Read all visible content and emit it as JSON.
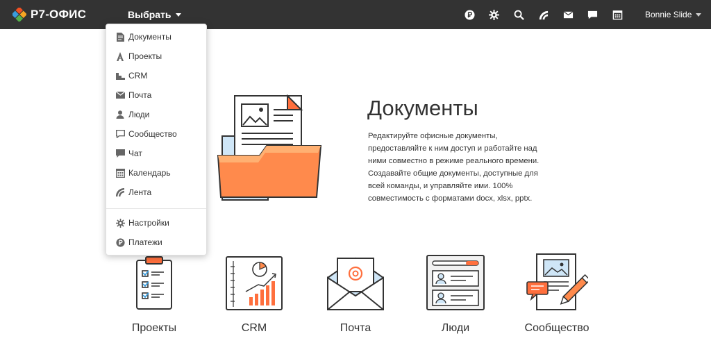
{
  "brand": {
    "name": "Р7-ОФИС"
  },
  "header": {
    "select_label": "Выбрать",
    "user_name": "Bonnie Slide",
    "icons": [
      "ruble-icon",
      "gear-icon",
      "search-icon",
      "feed-icon",
      "mail-icon",
      "chat-icon",
      "calendar-icon"
    ]
  },
  "dropdown": {
    "items": [
      {
        "label": "Документы",
        "icon": "document-icon"
      },
      {
        "label": "Проекты",
        "icon": "projects-icon"
      },
      {
        "label": "CRM",
        "icon": "crm-icon"
      },
      {
        "label": "Почта",
        "icon": "mail-icon"
      },
      {
        "label": "Люди",
        "icon": "person-icon"
      },
      {
        "label": "Сообщество",
        "icon": "community-icon"
      },
      {
        "label": "Чат",
        "icon": "chat-icon"
      },
      {
        "label": "Календарь",
        "icon": "calendar-icon"
      },
      {
        "label": "Лента",
        "icon": "feed-icon"
      }
    ],
    "bottom_items": [
      {
        "label": "Настройки",
        "icon": "gear-icon"
      },
      {
        "label": "Платежи",
        "icon": "ruble-icon"
      }
    ]
  },
  "hero": {
    "title": "Документы",
    "description": "Редактируйте офисные документы, предоставляйте к ним доступ и работайте над ними совместно в режиме реального времени. Создавайте общие документы, доступные для всей команды, и управляйте ими. 100% совместимость с форматами docx, xlsx, pptx."
  },
  "modules": [
    {
      "label": "Проекты",
      "icon": "projects-clipboard-icon"
    },
    {
      "label": "CRM",
      "icon": "crm-chart-icon"
    },
    {
      "label": "Почта",
      "icon": "mail-envelope-icon"
    },
    {
      "label": "Люди",
      "icon": "people-cards-icon"
    },
    {
      "label": "Сообщество",
      "icon": "community-icon"
    }
  ],
  "colors": {
    "topbar": "#333333",
    "accent": "#ff6f3d",
    "accent_light": "#ffb072"
  }
}
